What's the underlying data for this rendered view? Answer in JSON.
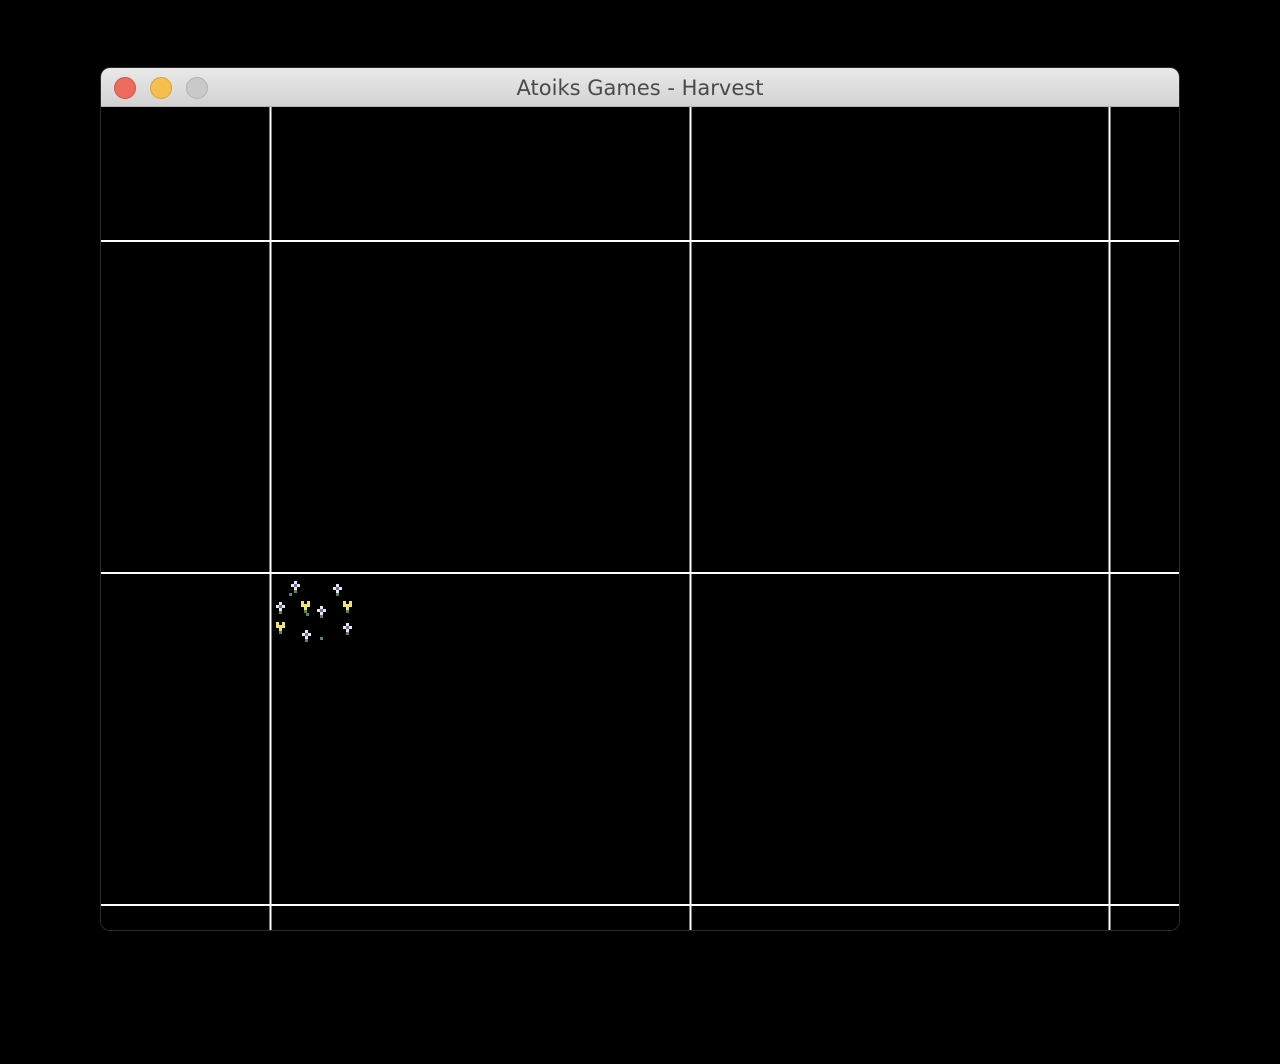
{
  "window": {
    "title": "Atoiks Games - Harvest",
    "controls": {
      "close": "close-icon",
      "minimize": "minimize-icon",
      "zoom": "zoom-icon"
    },
    "colors": {
      "close": "#ec6a5e",
      "minimize": "#f4bf4f",
      "zoom": "#c9c9c9"
    }
  },
  "game": {
    "background": "#000000",
    "grid_color": "#ffffff",
    "flower_colors": {
      "white_petal": "#e8e4f4",
      "white_center": "#7a6a9a",
      "yellow_petal": "#f2e36a",
      "stem": "#4f8a5a"
    },
    "flowers": [
      {
        "kind": "white"
      },
      {
        "kind": "white"
      },
      {
        "kind": "white"
      },
      {
        "kind": "yellow"
      },
      {
        "kind": "white"
      },
      {
        "kind": "yellow"
      },
      {
        "kind": "yellow"
      },
      {
        "kind": "white"
      },
      {
        "kind": "white"
      },
      {
        "kind": "sprout"
      },
      {
        "kind": "sprout"
      },
      {
        "kind": "sprout"
      }
    ]
  }
}
